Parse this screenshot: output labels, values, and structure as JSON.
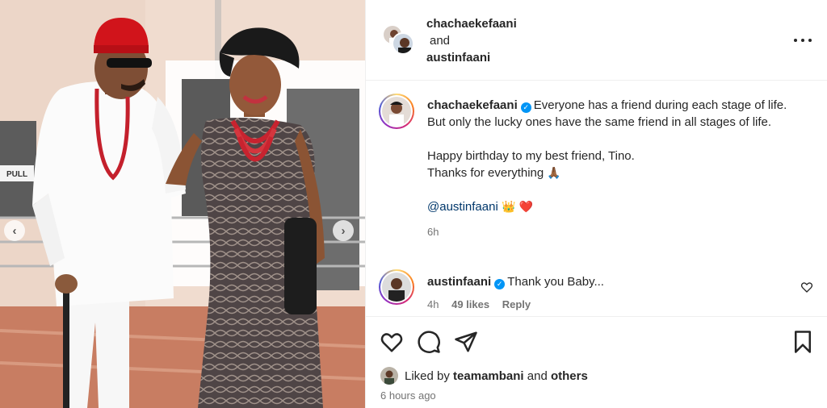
{
  "photo": {
    "door_sign": "PULL"
  },
  "header": {
    "user1": "chachaekefaani",
    "joiner": "and",
    "user2": "austinfaani"
  },
  "caption": {
    "username": "chachaekefaani",
    "line1": "Everyone has a friend during each stage of life. But only the lucky ones have the same friend in all stages of life.",
    "line2a": "Happy birthday to my best friend, Tino.",
    "line2b": "Thanks for everything",
    "prayer_emoji": "🙏🏾",
    "mention": "@austinfaani",
    "crown_emoji": "👑",
    "heart_emoji": "❤️",
    "time": "6h"
  },
  "comment": {
    "username": "austinfaani",
    "text": "Thank you Baby...",
    "time": "4h",
    "likes": "49 likes",
    "reply": "Reply"
  },
  "footer": {
    "liked_prefix": "Liked by",
    "liked_user": "teamambani",
    "liked_and": "and",
    "liked_others": "others",
    "time_ago": "6 hours ago"
  },
  "icons": {
    "verified": "verified-badge-icon",
    "like": "heart-icon",
    "comment": "comment-icon",
    "share": "paper-plane-icon",
    "save": "bookmark-icon"
  },
  "colors": {
    "accent": "#0095f6",
    "mention": "#00376b",
    "heart": "#ed4956"
  }
}
